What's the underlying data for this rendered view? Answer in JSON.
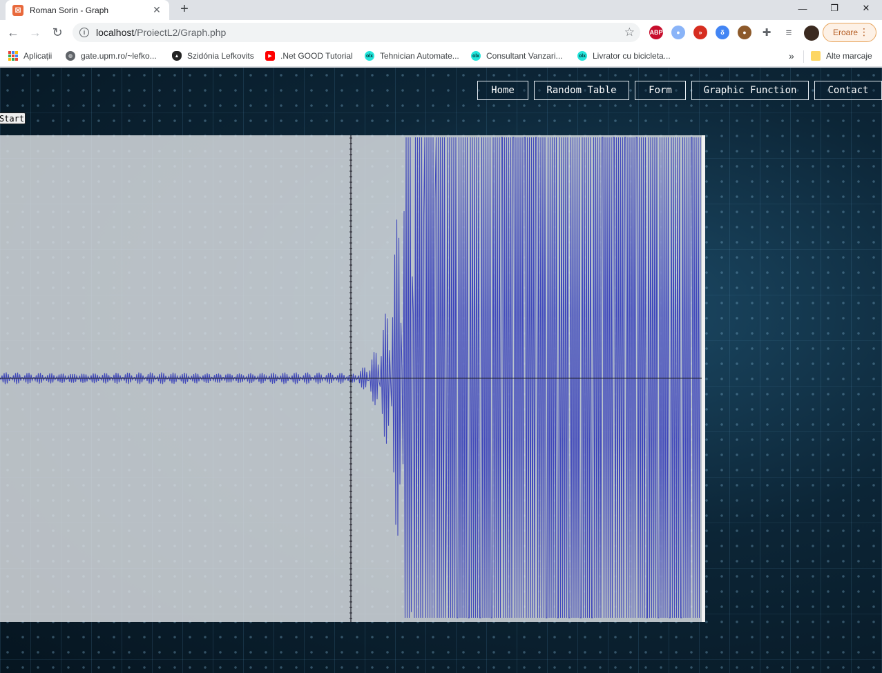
{
  "browser": {
    "tab_title": "Roman Sorin - Graph",
    "favicon_letter": "⊠",
    "url_host": "localhost",
    "url_path": "/ProiectL2/Graph.php",
    "profile_label": "Eroare",
    "extensions": [
      {
        "name": "adblock-plus-icon",
        "label": "ABP",
        "color": "#c70d2c"
      },
      {
        "name": "screen-recorder-icon",
        "label": "●",
        "color": "#8ab4f8"
      },
      {
        "name": "video-speed-icon",
        "label": "»",
        "color": "#d62d20"
      },
      {
        "name": "translator-icon",
        "label": "δ",
        "color": "#4285f4"
      },
      {
        "name": "cookie-icon",
        "label": "●",
        "color": "#8d5a2b"
      },
      {
        "name": "extensions-puzzle-icon",
        "label": "✚",
        "color": "#5f6368"
      },
      {
        "name": "media-queue-icon",
        "label": "≡",
        "color": "#5f6368"
      }
    ]
  },
  "bookmarks": {
    "items": [
      {
        "label": "Aplicații",
        "icon": "apps-grid-icon"
      },
      {
        "label": "gate.upm.ro/~lefko...",
        "icon": "globe-icon",
        "color": "#5f6368"
      },
      {
        "label": "Szidónia Lefkovits",
        "icon": "linux-penguin-icon",
        "color": "#222"
      },
      {
        "label": ".Net GOOD Tutorial",
        "icon": "youtube-icon",
        "color": "#ff0000"
      },
      {
        "label": "Tehnician Automate...",
        "icon": "olx-icon",
        "color": "#23e5db"
      },
      {
        "label": "Consultant Vanzari...",
        "icon": "olx-icon",
        "color": "#23e5db"
      },
      {
        "label": "Livrator cu bicicleta...",
        "icon": "olx-icon",
        "color": "#23e5db"
      }
    ],
    "overflow": "»",
    "other": "Alte marcaje"
  },
  "page": {
    "nav": [
      "Home",
      "Random Table",
      "Form",
      "Graphic Function",
      "Contact"
    ],
    "start_label": "Start"
  },
  "colors": {
    "wave": "#2a33b8",
    "graph_bg": "#dfe3e6",
    "axis": "#1e1e28"
  }
}
